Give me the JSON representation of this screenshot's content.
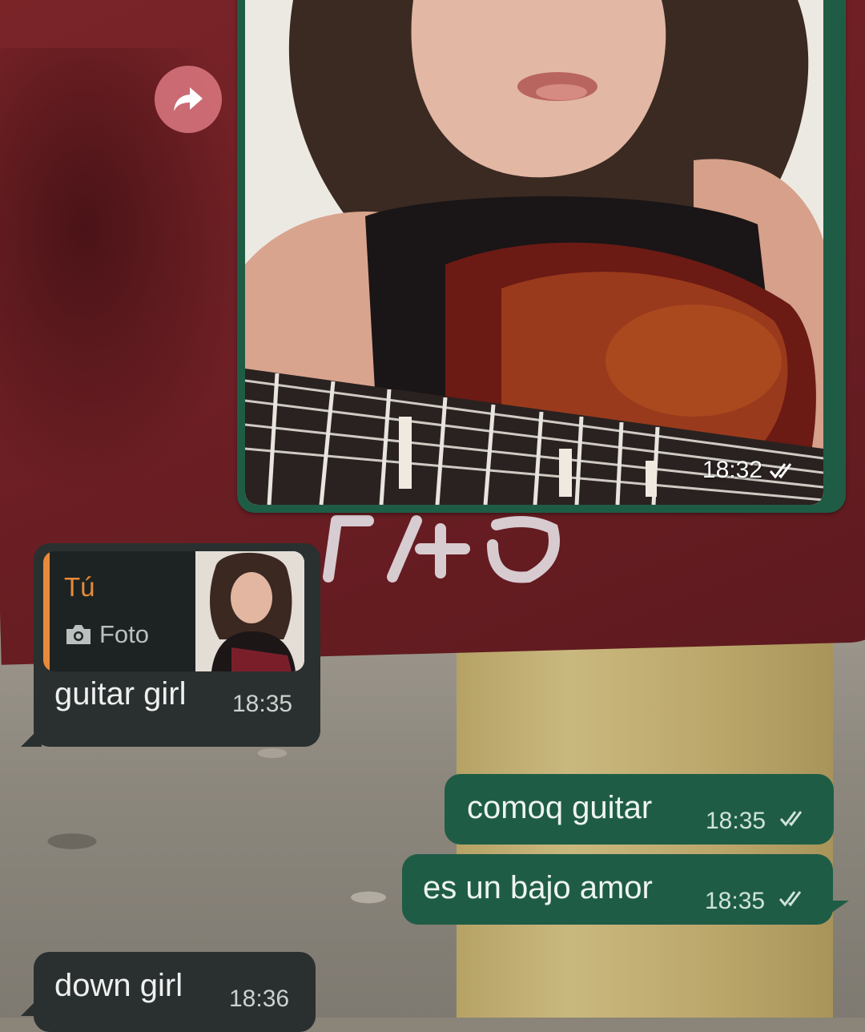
{
  "messages": {
    "image": {
      "time": "18:32",
      "status": "read"
    },
    "reply": {
      "quote_author": "Tú",
      "quote_type": "Foto",
      "text": "guitar girl",
      "time": "18:35"
    },
    "out1": {
      "text": "comoq guitar",
      "time": "18:35",
      "status": "read"
    },
    "out2": {
      "text": "es un bajo amor",
      "time": "18:35",
      "status": "read"
    },
    "in2": {
      "text": "down girl",
      "time": "18:36"
    }
  },
  "colors": {
    "incoming_bubble": "#2a302f",
    "outgoing_bubble": "#1f5c46",
    "quote_accent": "#e88a3a",
    "forward_button": "#dc7880"
  },
  "icons": [
    "forward-icon",
    "double-check-icon",
    "camera-icon"
  ]
}
